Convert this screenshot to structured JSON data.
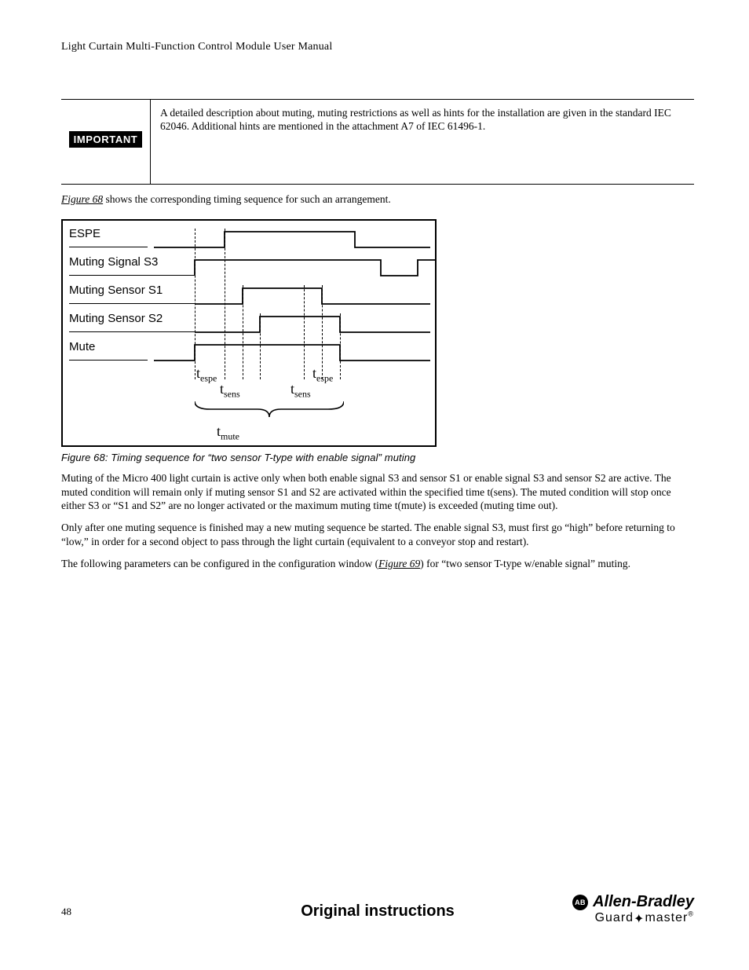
{
  "header": {
    "title": "Light Curtain Multi-Function Control Module User Manual"
  },
  "callout": {
    "badge": "IMPORTANT",
    "text": "A detailed description about muting, muting restrictions as well as hints for the installation are given in the standard IEC 62046. Additional hints are mentioned in the attachment A7 of IEC 61496-1."
  },
  "intro_line_prefix": "",
  "fig68_link": "Figure 68",
  "intro_line_suffix": " shows the corresponding timing sequence for such an arrangement.",
  "timing": {
    "rows": {
      "espe": "ESPE",
      "s3": "Muting Signal S3",
      "s1": "Muting Sensor S1",
      "s2": "Muting Sensor S2",
      "mute": "Mute"
    },
    "labels": {
      "tespe": "t",
      "tespe_sub": "espe",
      "tsens": "t",
      "tsens_sub": "sens",
      "tmute": "t",
      "tmute_sub": "mute"
    }
  },
  "fig68_caption": "Figure 68: Timing sequence for “two sensor T-type with enable signal” muting",
  "para1": "Muting of the Micro 400 light curtain is active only when both enable signal S3 and sensor S1 or enable signal S3 and sensor S2 are active. The muted condition will remain only if muting sensor S1 and S2 are activated within the specified time t(sens). The muted condition will stop once either S3 or “S1 and S2” are no longer activated or the maximum muting time t(mute) is exceeded (muting time out).",
  "para2": "Only after one muting sequence is finished may a new muting sequence be started. The enable signal S3, must first go “high” before returning to “low,” in order for a second object to pass through the light curtain (equivalent to a conveyor stop and restart).",
  "para3_prefix": "The following parameters can be configured in the configuration window (",
  "fig69_link": "Figure 69",
  "para3_suffix": ") for “two sensor T-type w/enable signal” muting.",
  "footer": {
    "page": "48",
    "title": "Original instructions",
    "brand_circle": "AB",
    "brand_top": "Allen-Bradley",
    "brand_bottom": "Guard",
    "brand_bottom2": "master",
    "reg": "®"
  }
}
